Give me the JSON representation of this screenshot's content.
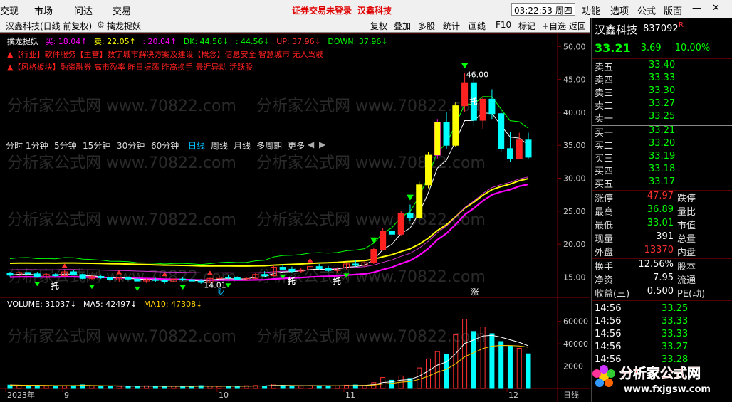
{
  "menu": {
    "items": [
      "交现",
      "市场",
      "问达",
      "交易"
    ],
    "notice": "证券交易未登录",
    "stock_name": "汉鑫科技",
    "time": "03:22:53 周四",
    "right_items": [
      "功能",
      "选项",
      "公式",
      "版面"
    ]
  },
  "toolbar": {
    "title": "汉鑫科技(日线 前复权)",
    "indicator": "擒龙捉妖",
    "buttons": [
      "复权",
      "叠加",
      "多股",
      "统计",
      "画线",
      "F10",
      "标记",
      "+自选",
      "返回"
    ]
  },
  "indicator_line": {
    "buy": "买: 18.04↑",
    "sell": "卖: 22.05↑",
    "v3": ": 20.04↑",
    "dk": "DK: 44.56↓",
    "v5": ": 44.56↓",
    "up": "UP: 37.96↓",
    "down": "DOWN: 37.96↓"
  },
  "info_lines": {
    "line1": "▲【行业】软件服务【主营】数字城市解决方案及建设【概念】信息安全 智慧城市 无人驾驶",
    "line2": "▲【风格板块】融资融券 高市盈率 昨日振荡 昨高换手 最近异动 活跃股"
  },
  "periods": [
    "分时",
    "1分钟",
    "5分钟",
    "15分钟",
    "30分钟",
    "60分钟",
    "日线",
    "周线",
    "月线",
    "多周期",
    "更多"
  ],
  "active_period": "日线",
  "price_axis": [
    "50.00",
    "45.00",
    "40.00",
    "35.00",
    "30.00",
    "25.00",
    "20.00",
    "15.00"
  ],
  "chart_labels": {
    "high": "46.00",
    "low": "14.01",
    "tag_cai": "财",
    "tag_zhang": "涨",
    "tuo": "托"
  },
  "volume_line": {
    "vol": "VOLUME: 31037↓",
    "ma5": "MA5: 42497↓",
    "ma10": "MA10: 47308↓"
  },
  "volume_axis": [
    "60000",
    "40000",
    "2000"
  ],
  "date_axis": [
    "2023年",
    "9",
    "10",
    "11",
    "12"
  ],
  "period_corner": "日线",
  "quote": {
    "name": "汉鑫科技",
    "code": "837092",
    "tag": "R",
    "price": "33.21",
    "change": "-3.69",
    "pct": "-10.00%",
    "asks": [
      {
        "label": "卖五",
        "price": "33.40"
      },
      {
        "label": "卖四",
        "price": "33.33"
      },
      {
        "label": "卖三",
        "price": "33.30"
      },
      {
        "label": "卖二",
        "price": "33.27"
      },
      {
        "label": "卖一",
        "price": "33.25"
      }
    ],
    "bids": [
      {
        "label": "买一",
        "price": "33.21"
      },
      {
        "label": "买二",
        "price": "33.20"
      },
      {
        "label": "买三",
        "price": "33.19"
      },
      {
        "label": "买四",
        "price": "33.18"
      },
      {
        "label": "买五",
        "price": "33.17"
      }
    ],
    "stats": [
      {
        "l": "涨停",
        "v": "47.97",
        "r": "跌停"
      },
      {
        "l": "最高",
        "v": "36.89",
        "r": "量比"
      },
      {
        "l": "最低",
        "v": "33.01",
        "r": "市值"
      },
      {
        "l": "现量",
        "v": "391",
        "r": "总量"
      },
      {
        "l": "外盘",
        "v": "13370",
        "r": "内盘"
      }
    ],
    "stats2": [
      {
        "l": "换手",
        "v": "12.56%",
        "r": "股本"
      },
      {
        "l": "净资",
        "v": "7.95",
        "r": "流通"
      },
      {
        "l": "收益(三)",
        "v": "0.500",
        "r": "PE(动)"
      }
    ],
    "ticks": [
      {
        "t": "14:56",
        "p": "33.25"
      },
      {
        "t": "14:56",
        "p": "33.33"
      },
      {
        "t": "14:56",
        "p": "33.33"
      },
      {
        "t": "14:56",
        "p": "33.27"
      },
      {
        "t": "14:56",
        "p": "33.28"
      }
    ]
  },
  "watermark": "分析家公式网 www.70822.com",
  "logo": {
    "text": "分析家公式网",
    "url": "www.fxjgsw.com"
  },
  "chart_data": {
    "type": "candlestick",
    "price_range": [
      13,
      51
    ],
    "candles": [
      [
        15.6,
        15.8,
        15.1,
        15.3
      ],
      [
        15.3,
        15.9,
        15.2,
        15.7
      ],
      [
        15.7,
        16.2,
        15.4,
        15.5
      ],
      [
        15.5,
        15.8,
        14.9,
        15.0
      ],
      [
        15.0,
        15.6,
        14.8,
        15.4
      ],
      [
        15.4,
        15.7,
        15.0,
        15.2
      ],
      [
        15.2,
        16.0,
        15.1,
        15.8
      ],
      [
        15.8,
        16.1,
        15.3,
        15.4
      ],
      [
        15.4,
        15.6,
        14.6,
        14.8
      ],
      [
        14.8,
        15.3,
        14.5,
        15.1
      ],
      [
        15.1,
        15.4,
        14.7,
        14.9
      ],
      [
        14.9,
        15.2,
        14.4,
        14.6
      ],
      [
        14.6,
        15.0,
        14.3,
        14.9
      ],
      [
        14.9,
        15.1,
        14.5,
        14.7
      ],
      [
        14.7,
        14.9,
        14.2,
        14.4
      ],
      [
        14.4,
        14.8,
        14.1,
        14.6
      ],
      [
        14.6,
        14.9,
        14.3,
        14.5
      ],
      [
        14.5,
        14.7,
        14.0,
        14.3
      ],
      [
        14.3,
        14.8,
        14.2,
        14.7
      ],
      [
        14.7,
        15.0,
        14.4,
        14.6
      ],
      [
        14.6,
        14.8,
        14.2,
        14.4
      ],
      [
        14.4,
        14.7,
        14.01,
        14.2
      ],
      [
        14.2,
        14.9,
        14.1,
        14.8
      ],
      [
        14.8,
        15.2,
        14.6,
        15.0
      ],
      [
        15.0,
        15.3,
        14.7,
        14.9
      ],
      [
        14.9,
        15.1,
        14.5,
        14.6
      ],
      [
        14.6,
        15.0,
        14.4,
        14.8
      ],
      [
        14.8,
        15.6,
        14.7,
        15.4
      ],
      [
        15.4,
        15.9,
        15.0,
        15.2
      ],
      [
        15.2,
        16.8,
        15.1,
        16.5
      ],
      [
        16.5,
        17.0,
        16.0,
        16.2
      ],
      [
        16.2,
        16.6,
        15.7,
        15.9
      ],
      [
        15.9,
        16.4,
        15.6,
        16.1
      ],
      [
        16.1,
        16.8,
        15.9,
        16.6
      ],
      [
        16.6,
        17.0,
        16.1,
        16.3
      ],
      [
        16.3,
        16.7,
        15.8,
        16.0
      ],
      [
        16.0,
        16.5,
        15.7,
        16.4
      ],
      [
        16.4,
        17.2,
        16.2,
        17.0
      ],
      [
        17.0,
        17.6,
        16.6,
        16.8
      ],
      [
        16.8,
        17.4,
        16.5,
        17.2
      ],
      [
        17.2,
        19.5,
        17.0,
        19.2
      ],
      [
        19.2,
        22.5,
        19.0,
        22.0
      ],
      [
        22.0,
        24.0,
        21.0,
        21.5
      ],
      [
        21.5,
        25.0,
        21.3,
        24.6
      ],
      [
        24.6,
        26.0,
        23.5,
        24.0
      ],
      [
        24.0,
        29.5,
        23.8,
        29.0
      ],
      [
        29.0,
        34.0,
        28.5,
        33.5
      ],
      [
        33.5,
        39.0,
        33.0,
        38.5
      ],
      [
        38.5,
        40.0,
        34.5,
        35.0
      ],
      [
        35.0,
        41.5,
        34.8,
        41.0
      ],
      [
        41.0,
        46.0,
        40.0,
        44.5
      ],
      [
        44.5,
        45.5,
        38.0,
        38.8
      ],
      [
        38.8,
        42.5,
        37.5,
        42.0
      ],
      [
        42.0,
        43.5,
        39.0,
        39.8
      ],
      [
        39.8,
        40.5,
        34.0,
        34.5
      ],
      [
        34.5,
        37.0,
        32.5,
        33.0
      ],
      [
        33.0,
        36.9,
        33.0,
        35.8
      ],
      [
        35.8,
        36.9,
        33.0,
        33.2
      ]
    ],
    "volume_range": [
      0,
      70000
    ],
    "volumes": [
      3000,
      2500,
      2200,
      2800,
      2100,
      1900,
      2400,
      2600,
      3200,
      2200,
      1800,
      2100,
      1900,
      1700,
      2000,
      2300,
      1800,
      1600,
      2100,
      1900,
      1700,
      2500,
      2200,
      1800,
      2000,
      1900,
      2400,
      2600,
      2200,
      3900,
      2800,
      2300,
      2100,
      2600,
      2400,
      2000,
      2300,
      2900,
      3100,
      2700,
      5200,
      9800,
      7400,
      11200,
      9000,
      18400,
      26500,
      33000,
      30500,
      48000,
      62000,
      51000,
      55000,
      49000,
      42000,
      38000,
      36000,
      31037
    ]
  }
}
